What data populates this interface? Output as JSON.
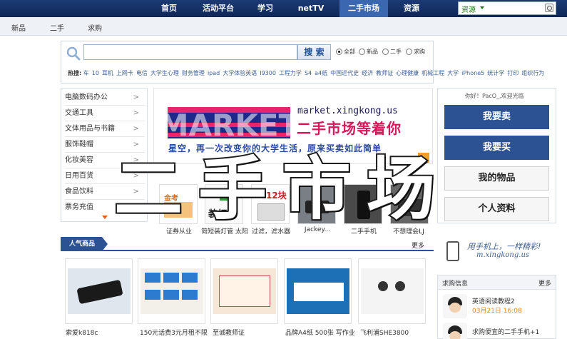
{
  "topnav": {
    "items": [
      "首页",
      "活动平台",
      "学习",
      "netTV",
      "二手市场",
      "资源"
    ],
    "active": "二手市场",
    "site_select": "资源"
  },
  "subnav": {
    "items": [
      "新品",
      "二手",
      "求购"
    ]
  },
  "search": {
    "placeholder": "",
    "button": "搜 索",
    "radios": [
      "全部",
      "新品",
      "二手",
      "求购"
    ],
    "selected": "全部"
  },
  "hot": {
    "label": "热搜:",
    "keywords": [
      "车",
      "10",
      "耳机",
      "上网卡",
      "电信",
      "大学生心理",
      "财务管理",
      "ipad",
      "大学体验英语",
      "I9300",
      "工程力学",
      "S4",
      "a4纸",
      "中国近代史",
      "经济",
      "教师证",
      "心理健康",
      "机械工程",
      "大学",
      "iPhone5",
      "统计学",
      "打印",
      "组织行为"
    ]
  },
  "categories": [
    {
      "label": "电脑数码办公",
      "arrow": ">"
    },
    {
      "label": "交通工具",
      "arrow": ">"
    },
    {
      "label": "文体用品与书籍",
      "arrow": ">"
    },
    {
      "label": "服饰鞋帽",
      "arrow": ">"
    },
    {
      "label": "化妆美容",
      "arrow": ">"
    },
    {
      "label": "日用百货",
      "arrow": ">"
    },
    {
      "label": "食品饮料",
      "arrow": ">"
    },
    {
      "label": "票务充值",
      "arrow": ">"
    }
  ],
  "banner": {
    "logo": "MARKET",
    "url": "market.xingkong.us",
    "slogan1": "二手市场等着你",
    "slogan2": "星空，再一次改变你的大学生活，原来买卖如此简单",
    "page_badge": "2"
  },
  "thumbs": [
    {
      "label": "证券从业",
      "icon": "book-icon",
      "img_text": "金考2014"
    },
    {
      "label": "简短装灯管 太阳",
      "icon": "lamp-icon",
      "img_text": "装灯管"
    },
    {
      "label": "过滤，滤水器",
      "icon": "filter-icon",
      "img_text": "12块"
    },
    {
      "label": "Jackey...",
      "icon": "device-icon",
      "img_text": ""
    },
    {
      "label": "二手手机",
      "icon": "phone-icon",
      "img_text": ""
    },
    {
      "label": "不想理会LJ",
      "icon": "item-icon",
      "img_text": ""
    }
  ],
  "user": {
    "welcome": "你好！PacO_,欢迎光临",
    "sell": "我要卖",
    "buy": "我要买",
    "my_items": "我的物品",
    "profile": "个人资料"
  },
  "app_promo": {
    "slogan": "用手机上，一样精彩!",
    "url": "m.xingkong.us"
  },
  "popular": {
    "title": "人气商品",
    "more": "更多",
    "items": [
      {
        "label": "索爱k818c",
        "icon": "phone-icon"
      },
      {
        "label": "150元话费3元月租不限",
        "icon": "simcard-icon"
      },
      {
        "label": "至诚教师证",
        "icon": "certificate-icon"
      },
      {
        "label": "品牌A4纸 500张 写作业",
        "icon": "paper-icon"
      },
      {
        "label": "飞利浦SHE3800",
        "icon": "earphone-icon"
      }
    ]
  },
  "wanted": {
    "title": "求购信息",
    "more": "更多",
    "items": [
      {
        "text": "英语阅读教程2",
        "date": "03月21日 16:08"
      },
      {
        "text": "求购便宜的二手手机+1",
        "date": ""
      }
    ]
  },
  "overlay": {
    "text": "二手市场"
  },
  "colors": {
    "nav": "#1c3a74",
    "accent": "#2c5294",
    "date": "#e8841b",
    "slogan": "#d8185a"
  }
}
